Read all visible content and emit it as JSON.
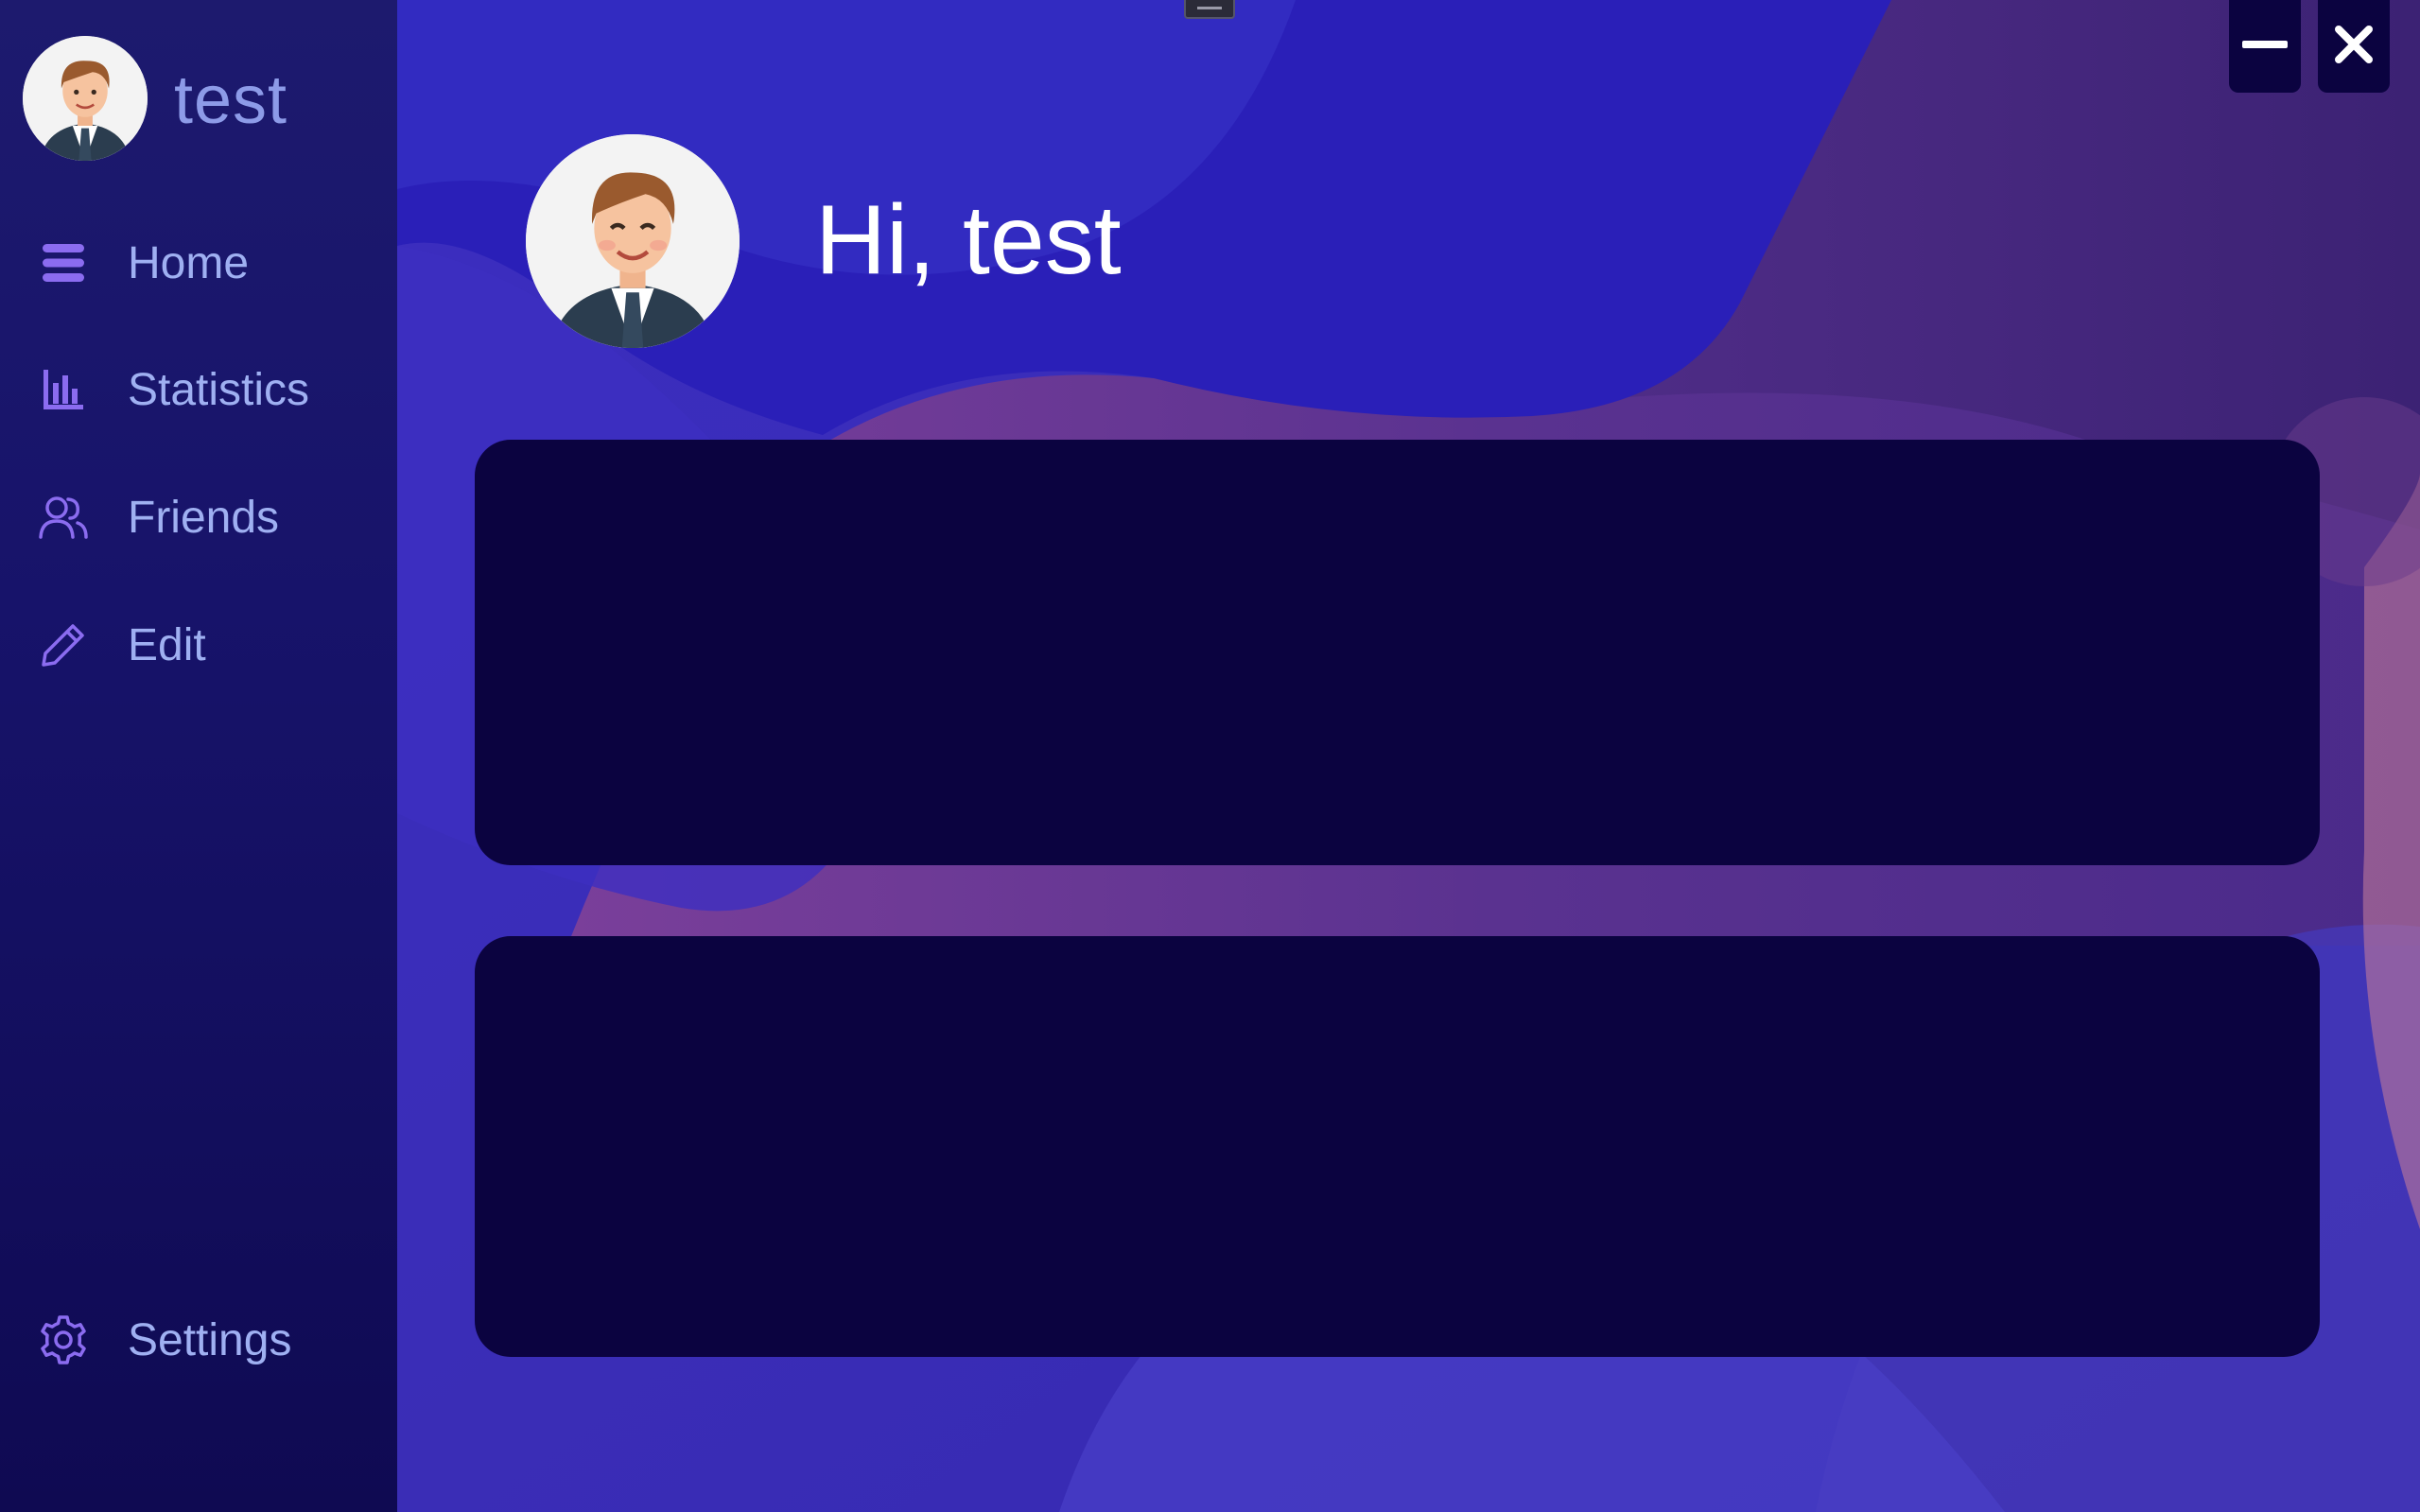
{
  "sidebar": {
    "username": "test",
    "items": [
      {
        "label": "Home",
        "icon": "menu-icon"
      },
      {
        "label": "Statistics",
        "icon": "bar-chart-icon"
      },
      {
        "label": "Friends",
        "icon": "users-icon"
      },
      {
        "label": "Edit",
        "icon": "pencil-icon"
      }
    ],
    "settings": {
      "label": "Settings",
      "icon": "gear-icon"
    }
  },
  "main": {
    "greeting": "Hi, test",
    "panels": [
      "",
      ""
    ]
  },
  "window_controls": {
    "minimize": "minimize-icon",
    "close": "close-icon"
  },
  "colors": {
    "accent": "#8b6cf0",
    "sidebar_text": "#9fb0f2",
    "panel_bg": "#0b0340",
    "main_bg": "#3a2bbf"
  }
}
